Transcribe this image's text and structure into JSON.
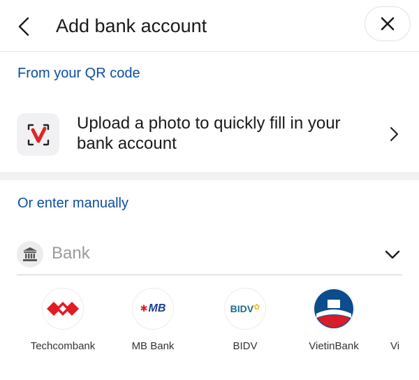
{
  "header": {
    "title": "Add bank account",
    "back_icon": "chevron-left-icon",
    "close_icon": "close-icon"
  },
  "qr_section": {
    "label": "From your QR code",
    "upload_text": "Upload a photo to quickly fill in your bank account",
    "icon": "qr-scan-icon"
  },
  "manual_section": {
    "label": "Or enter manually",
    "bank_placeholder": "Bank",
    "bank_icon": "bank-icon"
  },
  "banks": [
    {
      "name": "Techcombank",
      "logo": "techcombank-logo"
    },
    {
      "name": "MB Bank",
      "logo": "mb-bank-logo",
      "logo_text": "MB"
    },
    {
      "name": "BIDV",
      "logo": "bidv-logo",
      "logo_text": "BIDV"
    },
    {
      "name": "VietinBank",
      "logo": "vietinbank-logo"
    },
    {
      "name": "Vi",
      "logo": "partial-bank-logo"
    }
  ],
  "colors": {
    "accent_blue": "#0b4ea2",
    "techcombank_red": "#e31b23",
    "mb_blue": "#1a3f9b",
    "mb_red": "#e31b23",
    "bidv_teal": "#1a6f8a",
    "bidv_gold": "#f2b705",
    "vietin_blue": "#0a4c8c",
    "vietin_red": "#d91c2a"
  }
}
